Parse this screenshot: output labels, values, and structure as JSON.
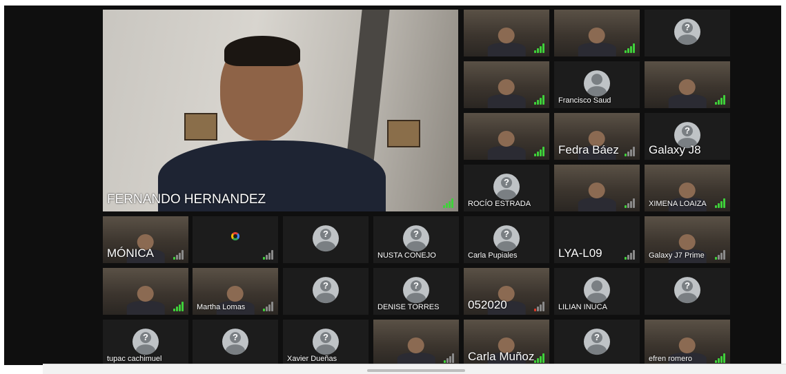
{
  "main_speaker": {
    "name": "FERNANDO HERNANDEZ",
    "signal": "good"
  },
  "participants": [
    {
      "name": "",
      "type": "photo",
      "signal": "good"
    },
    {
      "name": "",
      "type": "photo",
      "signal": "good"
    },
    {
      "name": "",
      "type": "unknown",
      "signal": "none"
    },
    {
      "name": "",
      "type": "photo",
      "signal": "good"
    },
    {
      "name": "Francisco Saud",
      "type": "avatar",
      "signal": "none"
    },
    {
      "name": "",
      "type": "photo",
      "signal": "good"
    },
    {
      "name": "",
      "type": "photo",
      "signal": "good"
    },
    {
      "name": "Fedra Báez",
      "type": "photo",
      "signal": "weak",
      "big": true
    },
    {
      "name": "Galaxy J8",
      "type": "unknown",
      "signal": "none",
      "big": true
    },
    {
      "name": "ROCÍO ESTRADA",
      "type": "unknown",
      "signal": "none"
    },
    {
      "name": "",
      "type": "photo",
      "signal": "weak"
    },
    {
      "name": "XIMENA LOAIZA",
      "type": "photo",
      "signal": "good"
    },
    {
      "name": "MÓNICA",
      "type": "photo",
      "signal": "weak",
      "big": true
    },
    {
      "name": "",
      "type": "google",
      "signal": "weak"
    },
    {
      "name": "",
      "type": "unknown",
      "signal": "none"
    },
    {
      "name": "NUSTA CONEJO",
      "type": "unknown",
      "signal": "none"
    },
    {
      "name": "Carla Pupiales",
      "type": "unknown",
      "signal": "none"
    },
    {
      "name": "LYA-L09",
      "type": "empty",
      "signal": "weak",
      "big": true
    },
    {
      "name": "Galaxy J7 Prime",
      "type": "photo",
      "signal": "weak"
    },
    {
      "name": "",
      "type": "photo",
      "signal": "good"
    },
    {
      "name": "Martha Lomas",
      "type": "photo",
      "signal": "weak"
    },
    {
      "name": "",
      "type": "unknown",
      "signal": "none"
    },
    {
      "name": "DENISE TORRES",
      "type": "unknown",
      "signal": "none"
    },
    {
      "name": "052020",
      "type": "photo",
      "signal": "bad",
      "big": true
    },
    {
      "name": "LILIAN INUCA",
      "type": "avatar",
      "signal": "none"
    },
    {
      "name": "",
      "type": "unknown",
      "signal": "none"
    },
    {
      "name": "tupac cachimuel",
      "type": "unknown",
      "signal": "none"
    },
    {
      "name": "",
      "type": "unknown",
      "signal": "none"
    },
    {
      "name": "Xavier Dueñas",
      "type": "unknown",
      "signal": "none"
    },
    {
      "name": "",
      "type": "photo",
      "signal": "weak"
    },
    {
      "name": "Carla Muñoz",
      "type": "photo",
      "signal": "good",
      "big": true
    },
    {
      "name": "",
      "type": "unknown",
      "signal": "none"
    },
    {
      "name": "efren romero",
      "type": "photo",
      "signal": "good"
    }
  ]
}
